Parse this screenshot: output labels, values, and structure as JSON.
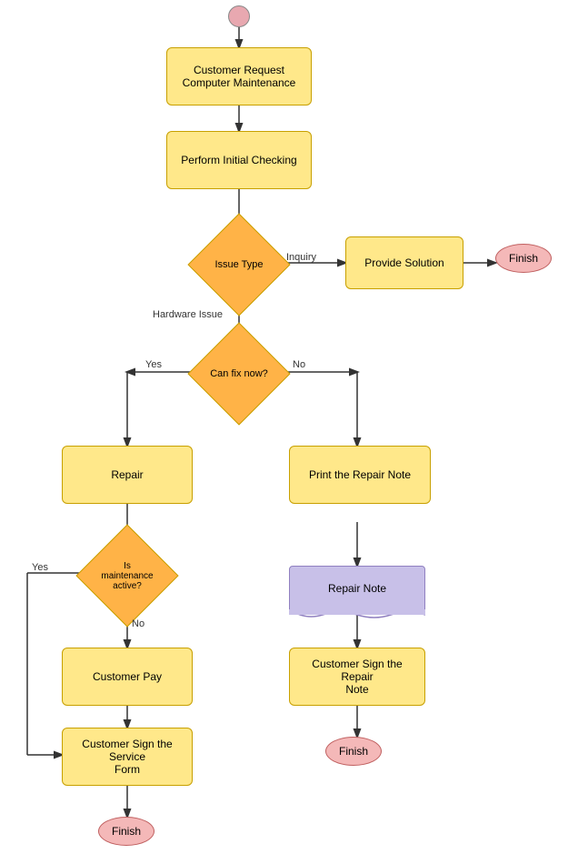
{
  "nodes": {
    "start": {
      "label": ""
    },
    "customer_request": {
      "label": "Customer Request\nComputer Maintenance"
    },
    "perform_checking": {
      "label": "Perform Initial Checking"
    },
    "issue_type": {
      "label": "Issue Type"
    },
    "provide_solution": {
      "label": "Provide Solution"
    },
    "finish1": {
      "label": "Finish"
    },
    "can_fix": {
      "label": "Can fix now?"
    },
    "repair": {
      "label": "Repair"
    },
    "print_repair_note": {
      "label": "Print the Repair Note"
    },
    "repair_note_doc": {
      "label": "Repair Note"
    },
    "is_maintenance": {
      "label": "Is\nmaintenance\nactive?"
    },
    "customer_pay": {
      "label": "Customer Pay"
    },
    "customer_sign_service": {
      "label": "Customer Sign the Service\nForm"
    },
    "customer_sign_repair": {
      "label": "Customer Sign the Repair\nNote"
    },
    "finish2": {
      "label": "Finish"
    },
    "finish3": {
      "label": "Finish"
    }
  },
  "labels": {
    "inquiry": "Inquiry",
    "hardware_issue": "Hardware Issue",
    "yes_canfix": "Yes",
    "no_canfix": "No",
    "yes_maint": "Yes",
    "no_maint": "No"
  }
}
